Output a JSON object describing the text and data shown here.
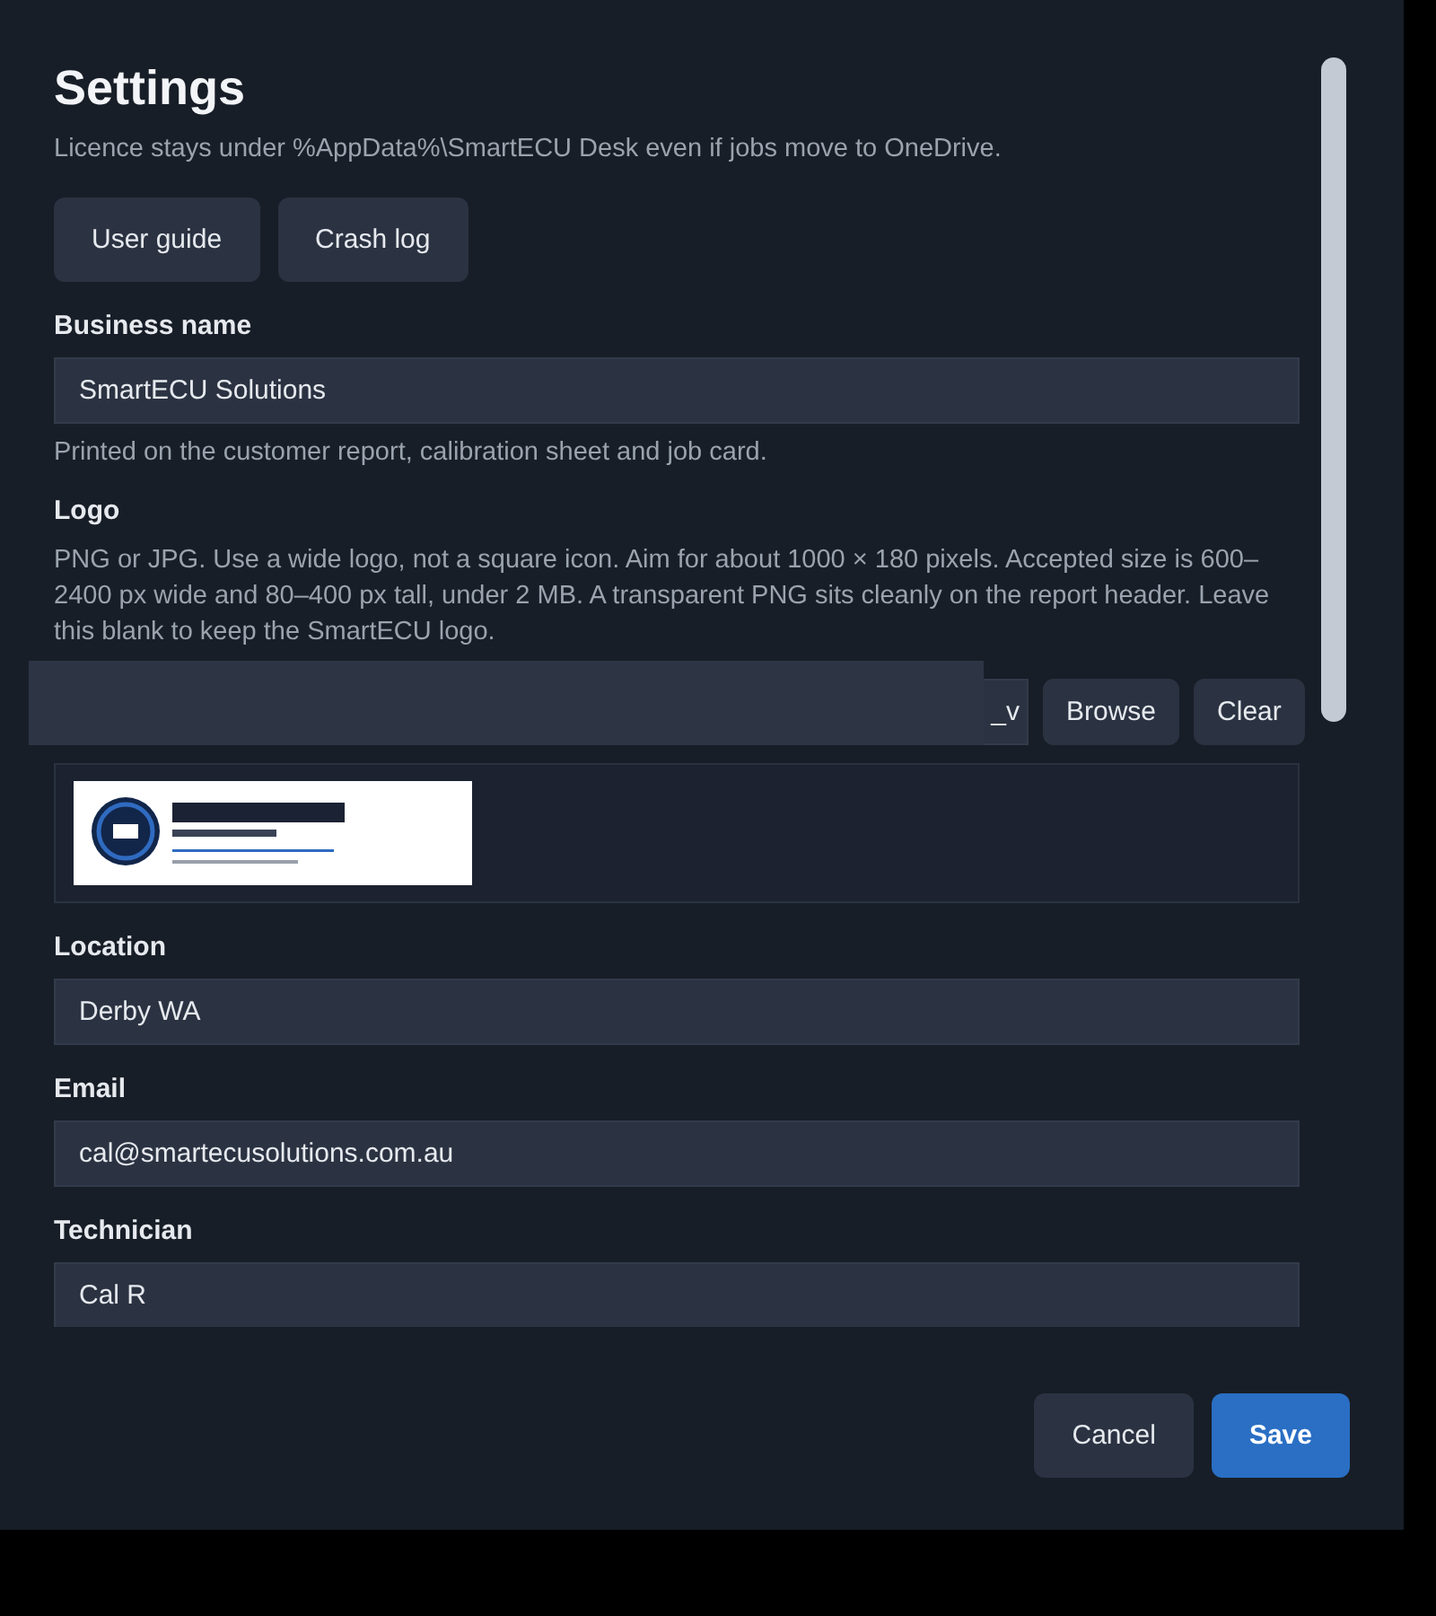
{
  "dialog": {
    "title": "Settings",
    "subtitle": "Licence stays under %AppData%\\SmartECU Desk even if jobs move to OneDrive.",
    "top_buttons": [
      "User guide",
      "Crash log"
    ],
    "business": {
      "label": "Business name",
      "value": "SmartECU Solutions",
      "hint": "Printed on the customer report, calibration sheet and job card."
    },
    "logo": {
      "label": "Logo",
      "hint": "PNG or JPG. Use a wide logo, not a square icon. Aim for about 1000 × 180 pixels. Accepted size is 600–2400 px wide and 80–400 px tall, under 2 MB. A transparent PNG sits cleanly on the report header. Leave this blank to keep the SmartECU logo.",
      "value": "_v",
      "buttons": [
        "Browse",
        "Clear"
      ],
      "preview": {
        "kind": "picture"
      }
    },
    "fields": [
      {
        "label": "Location",
        "value": "Derby WA"
      },
      {
        "label": "Email",
        "value": "cal@smartecusolutions.com.au"
      },
      {
        "label": "Technician",
        "value": "Cal R"
      }
    ],
    "footer": [
      {
        "label": "Cancel",
        "kind": "secondary"
      },
      {
        "label": "Save",
        "kind": "primary"
      }
    ]
  }
}
